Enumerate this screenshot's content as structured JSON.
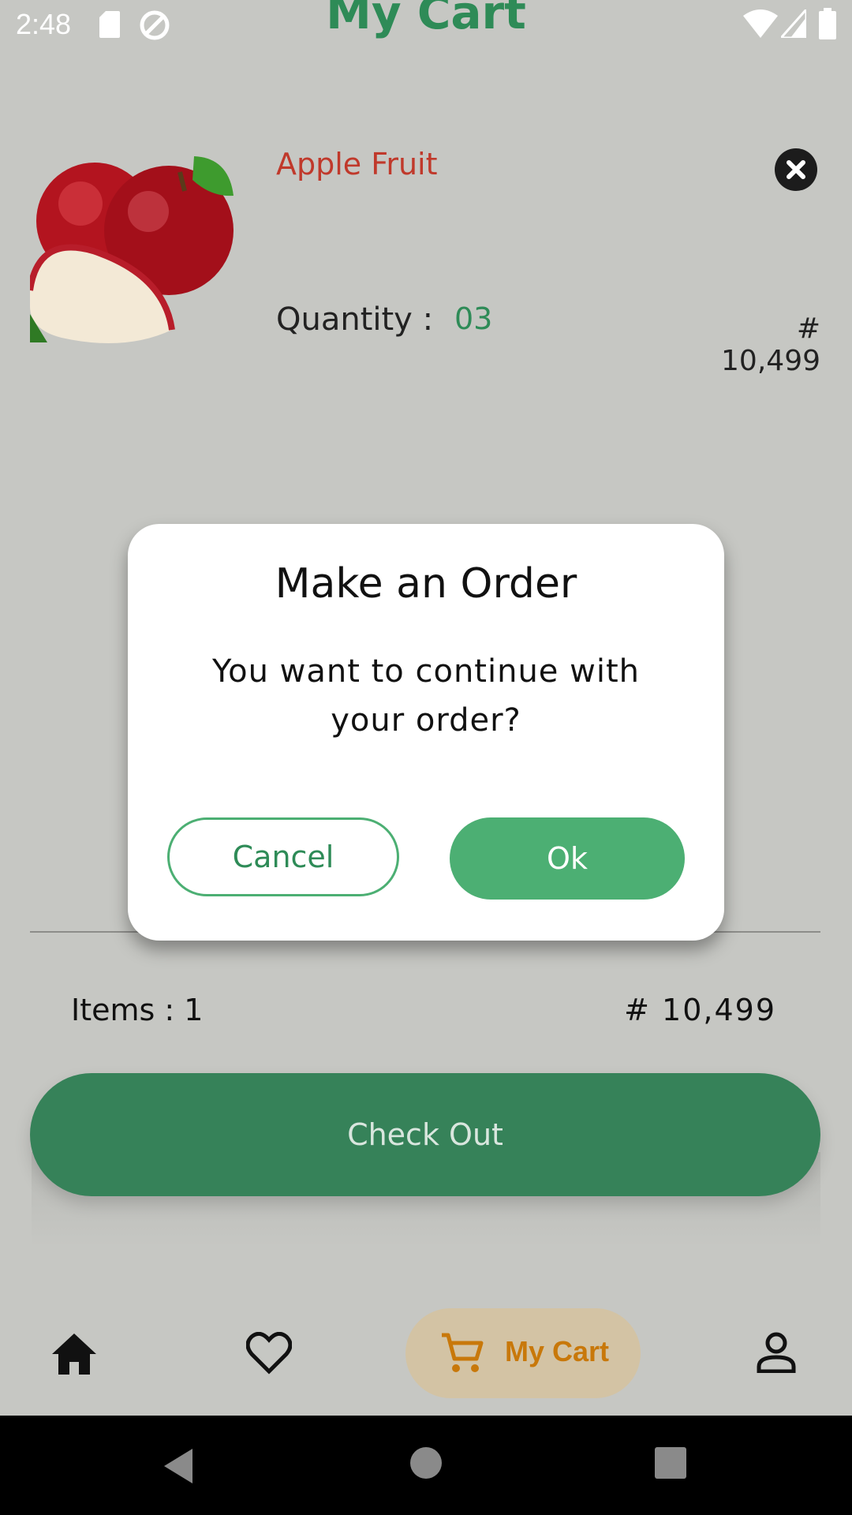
{
  "status_bar": {
    "time": "2:48"
  },
  "page": {
    "title": "My Cart"
  },
  "cart_item": {
    "name": "Apple Fruit",
    "quantity_label": "Quantity :",
    "quantity_value": "03",
    "price": "# 10,499"
  },
  "summary": {
    "items_label": "Items : 1",
    "total": "# 10,499",
    "checkout_label": "Check Out"
  },
  "bottom_nav": {
    "items": [
      {
        "icon": "home-icon"
      },
      {
        "icon": "heart-icon"
      },
      {
        "icon": "cart-icon",
        "label": "My Cart",
        "active": true
      },
      {
        "icon": "profile-icon"
      }
    ]
  },
  "dialog": {
    "title": "Make an Order",
    "message": "You want to continue with your order?",
    "cancel_label": "Cancel",
    "ok_label": "Ok"
  },
  "colors": {
    "primary_green": "#4caf73",
    "checkout_green": "#368259",
    "item_name_red": "#c0392b",
    "active_nav_orange": "#c8780a"
  }
}
